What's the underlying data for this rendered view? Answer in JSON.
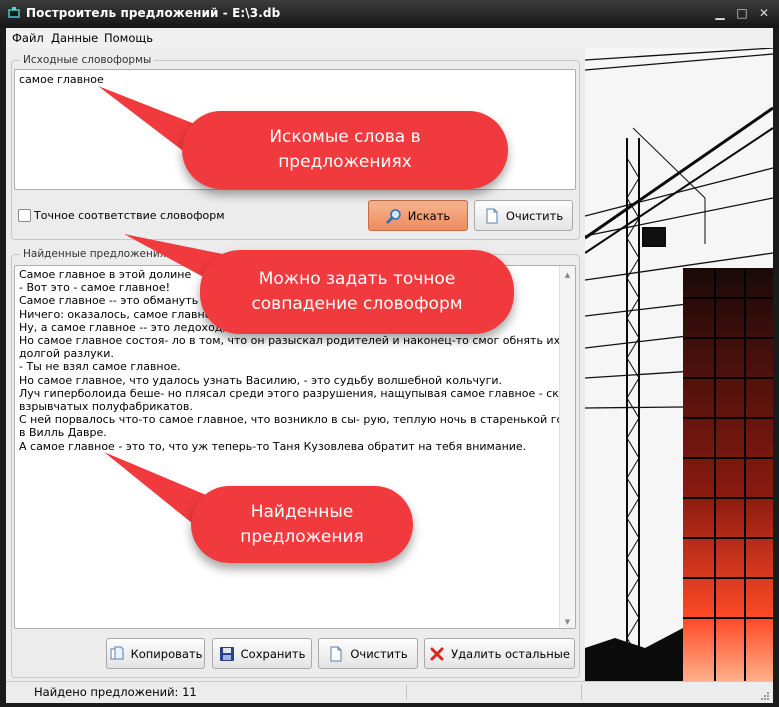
{
  "window": {
    "title": "Построитель предложений - E:\\3.db",
    "controls": {
      "minimize": "▁",
      "maximize": "□",
      "close": "✕"
    }
  },
  "menu": [
    "Файл",
    "Данные",
    "Помощь"
  ],
  "source_group": {
    "legend": "Исходные словоформы",
    "input_value": "самое главное",
    "exact_match_label": "Точное соответствие словоформ",
    "exact_match_checked": false,
    "search_button": "Искать",
    "clear_button": "Очистить"
  },
  "results_group": {
    "legend": "Найденные предложения",
    "lines": [
      "Самое главное в этой долине",
      "- Вот это - самое главное!",
      "Самое главное -- это обмануть пч",
      "Ничего: оказалось, самое главное",
      "Ну, а самое главное -- это ледоход,",
      "Но самое главное состоя- ло в том, что он разыскал родителей и наконец-то смог обнять их после",
      "долгой разлуки.",
      "- Ты не взял самое главное.",
      "Но самое главное, что удалось узнать Василию, - это судьбу волшебной кольчуги.",
      "Луч гиперболоида беше- но плясал среди этого разрушения, нащупывая самое главное - склады",
      "взрывчатых полуфабрикатов.",
      "С ней порвалось что-то самое главное, что возникло в сы- рую, теплую ночь в старенькой гостинице",
      "в Вилль Давре.",
      "А самое главное - это то, что уж теперь-то Таня Кузовлева обратит на тебя внимание."
    ],
    "buttons": {
      "copy": "Копировать",
      "save": "Сохранить",
      "clear": "Очистить",
      "delete_others": "Удалить остальные"
    }
  },
  "status": {
    "found_text": "Найдено предложений: 11"
  },
  "callouts": {
    "search_words": "Искомые слова в\nпредложениях",
    "exact_match": "Можно задать точное\nсовпадение словоформ",
    "found_sentences": "Найденные\nпредложения"
  },
  "colors": {
    "callout": "#f03a3e",
    "search_button": "#ef8a5f",
    "title_bar": "#1e1e1e"
  },
  "icons": {
    "app": "app-icon",
    "search": "magnifier-icon",
    "clear": "document-icon",
    "copy": "copy-icon",
    "save": "floppy-icon",
    "delete": "red-x-icon"
  }
}
